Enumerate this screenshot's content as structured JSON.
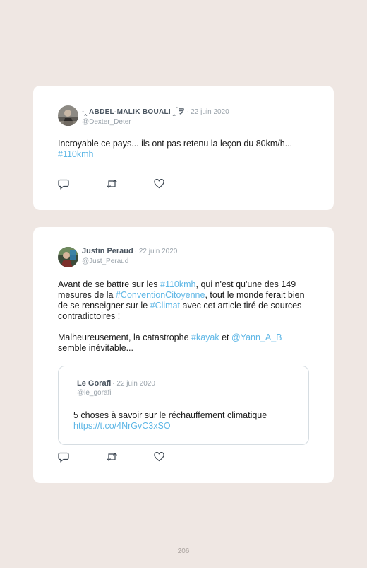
{
  "tweets": [
    {
      "display_name": "-‸ ABDEL-MALIK BOUALI ‸ ́ヲ",
      "date": "· 22 juin 2020",
      "handle": "@Dexter_Deter",
      "text_plain": "Incroyable ce pays... ils ont pas retenu la leçon du 80km/h...",
      "text_hashtag": "#110kmh"
    },
    {
      "display_name": "Justin Peraud",
      "date": "· 22 juin 2020",
      "handle": "@Just_Peraud",
      "p1_a": "Avant de se battre sur les ",
      "p1_tag1": "#110kmh",
      "p1_b": ", qui n'est qu'une des 149 mesures de la ",
      "p1_tag2": "#ConventionCitoyenne",
      "p1_c": ", tout le monde ferait bien de se renseigner sur le ",
      "p1_tag3": "#Climat",
      "p1_d": " avec cet article tiré de sources contradictoires !",
      "p2_a": "Malheureusement, la catastrophe ",
      "p2_tag": "#kayak",
      "p2_b": " et ",
      "p2_mention": "@Yann_A_B",
      "p2_c": " semble inévitable...",
      "quote": {
        "display_name": "Le Gorafi",
        "date": "· 22 juin 2020",
        "handle": "@le_gorafi",
        "text": "5 choses à savoir sur le réchauffement climatique",
        "link": "https://t.co/4NrGvC3xSO"
      }
    }
  ],
  "page_number": "206",
  "icons": [
    "reply-icon",
    "retweet-icon",
    "like-icon"
  ],
  "colors": {
    "background": "#efe7e3",
    "link": "#5fb7e6",
    "muted": "#9aa3ab"
  }
}
